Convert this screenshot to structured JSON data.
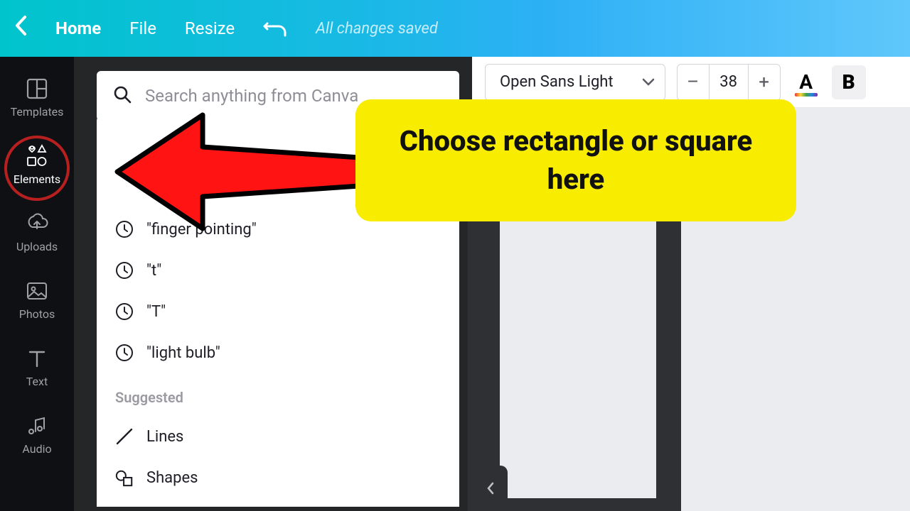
{
  "topbar": {
    "home": "Home",
    "file": "File",
    "resize": "Resize",
    "saved": "All changes saved"
  },
  "sidebar": {
    "items": [
      {
        "label": "Templates",
        "icon": "templates"
      },
      {
        "label": "Elements",
        "icon": "elements",
        "active": true
      },
      {
        "label": "Uploads",
        "icon": "uploads"
      },
      {
        "label": "Photos",
        "icon": "photos"
      },
      {
        "label": "Text",
        "icon": "text"
      },
      {
        "label": "Audio",
        "icon": "audio"
      }
    ]
  },
  "search": {
    "placeholder": "Search anything from Canva"
  },
  "recent": [
    "\"finger pointing\"",
    "\"t\"",
    "\"T\"",
    "\"light bulb\""
  ],
  "suggested_heading": "Suggested",
  "suggested": [
    {
      "label": "Lines",
      "icon": "line"
    },
    {
      "label": "Shapes",
      "icon": "shapes"
    }
  ],
  "toolbar": {
    "font": "Open Sans Light",
    "size": "38",
    "text_color_glyph": "A",
    "bold_glyph": "B"
  },
  "annotation": {
    "text": "Choose rectangle or square here"
  }
}
